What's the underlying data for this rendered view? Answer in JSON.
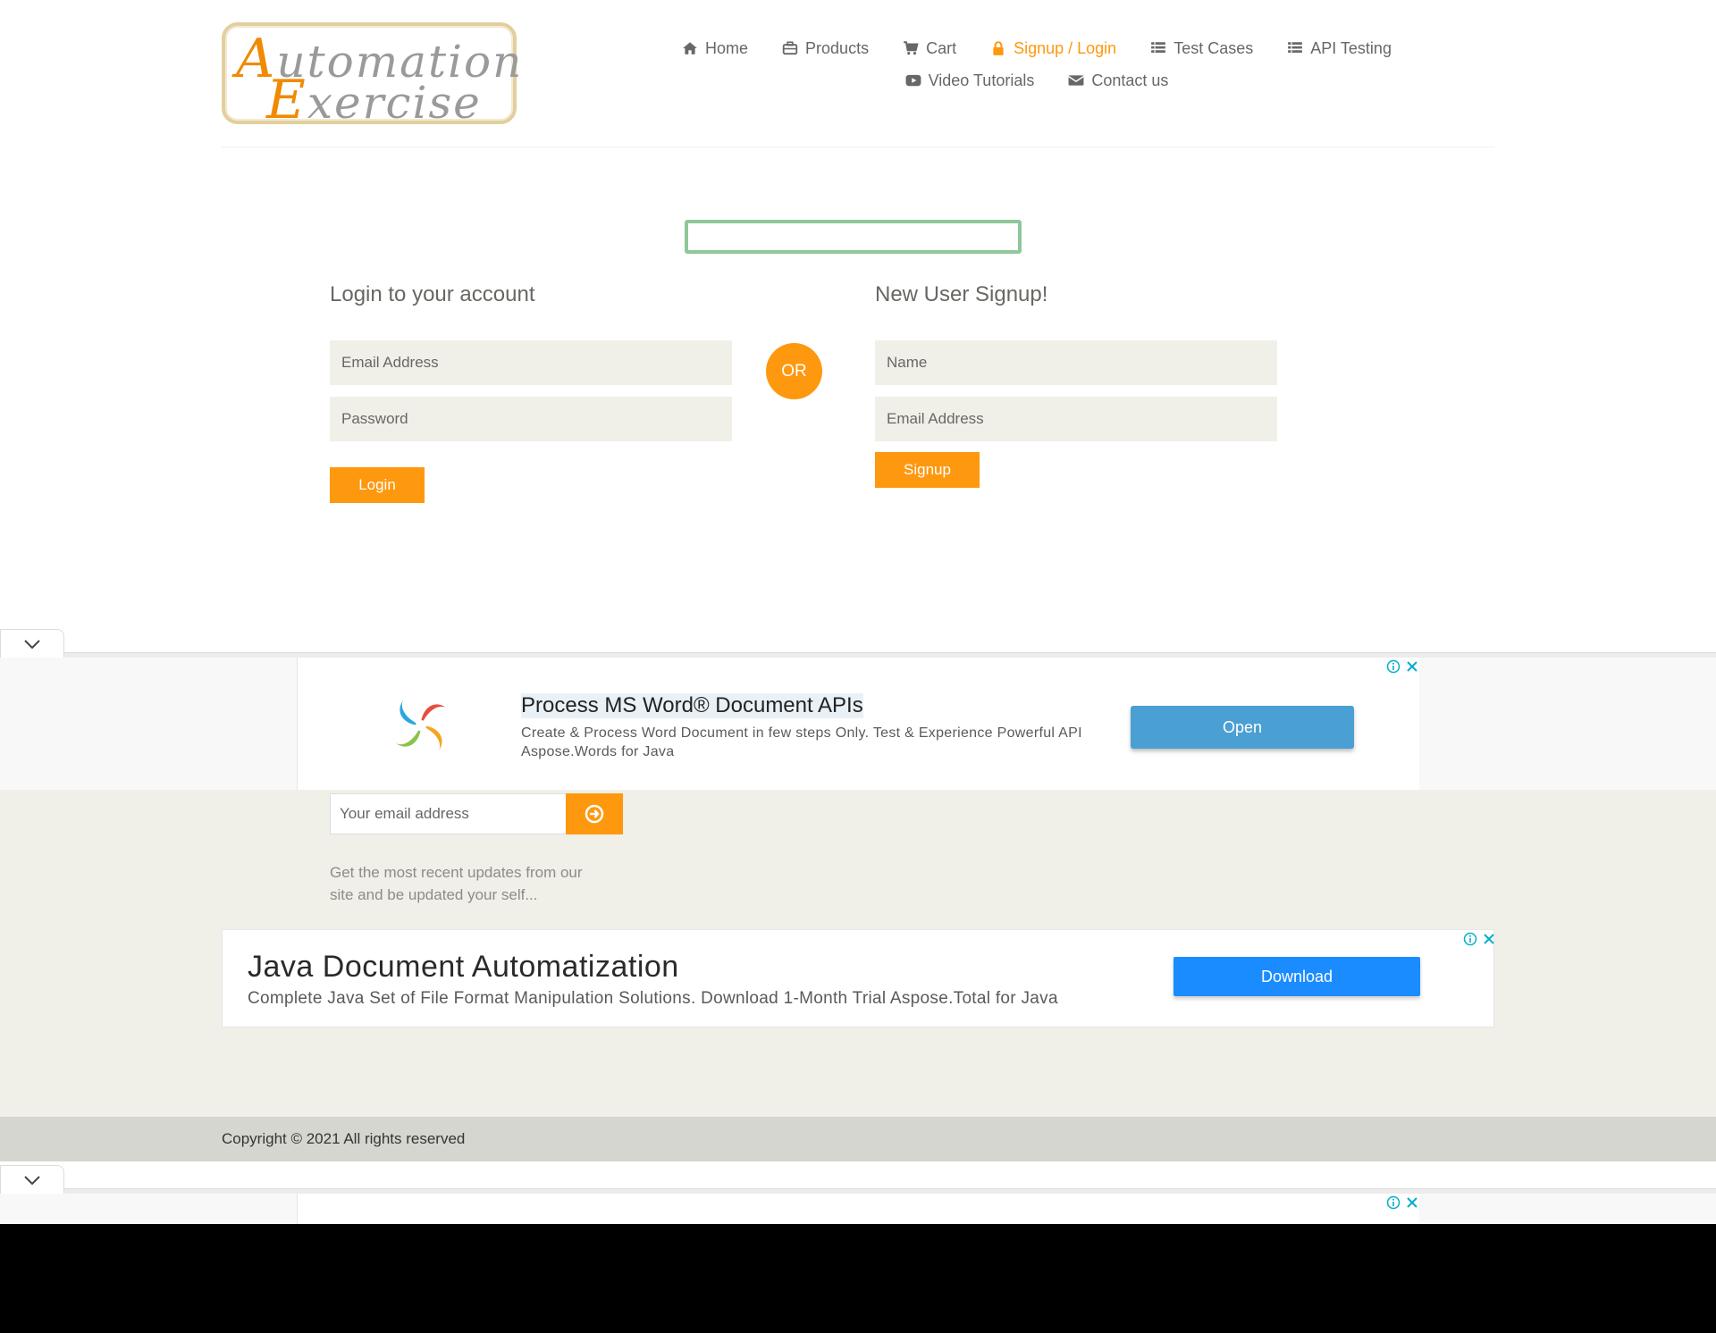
{
  "logo": {
    "line1_cap": "A",
    "line1_rest": "utomation",
    "line2_cap": "E",
    "line2_rest": "xercise"
  },
  "nav": {
    "row1": [
      {
        "label": "Home",
        "icon": "home-icon"
      },
      {
        "label": "Products",
        "icon": "briefcase-icon"
      },
      {
        "label": "Cart",
        "icon": "cart-icon"
      },
      {
        "label": "Signup / Login",
        "icon": "lock-icon",
        "active": true
      },
      {
        "label": "Test Cases",
        "icon": "list-icon"
      },
      {
        "label": "API Testing",
        "icon": "list-icon"
      }
    ],
    "row2": [
      {
        "label": "Video Tutorials",
        "icon": "youtube-play-icon"
      },
      {
        "label": "Contact us",
        "icon": "envelope-icon"
      }
    ]
  },
  "login": {
    "title": "Login to your account",
    "email_placeholder": "Email Address",
    "password_placeholder": "Password",
    "button": "Login"
  },
  "or_label": "OR",
  "signup": {
    "title": "New User Signup!",
    "name_placeholder": "Name",
    "email_placeholder": "Email Address",
    "button": "Signup"
  },
  "ad1": {
    "title": "Process MS Word® Document APIs",
    "description": "Create & Process Word Document in few steps Only. Test & Experience Powerful API Aspose.Words for Java",
    "button": "Open"
  },
  "subscription": {
    "placeholder": "Your email address",
    "text": "Get the most recent updates from our site and be updated your self..."
  },
  "ad2": {
    "title": "Java Document Automatization",
    "description": "Complete Java Set of File Format Manipulation Solutions. Download 1-Month Trial Aspose.Total for Java",
    "button": "Download"
  },
  "footer": {
    "copyright": "Copyright © 2021 All rights reserved"
  },
  "colors": {
    "accent": "#fe980f",
    "text": "#696763",
    "field_bg": "#f0f0e9",
    "success_border": "#8fc79a",
    "ad_button_blue": "#1a8cff"
  }
}
